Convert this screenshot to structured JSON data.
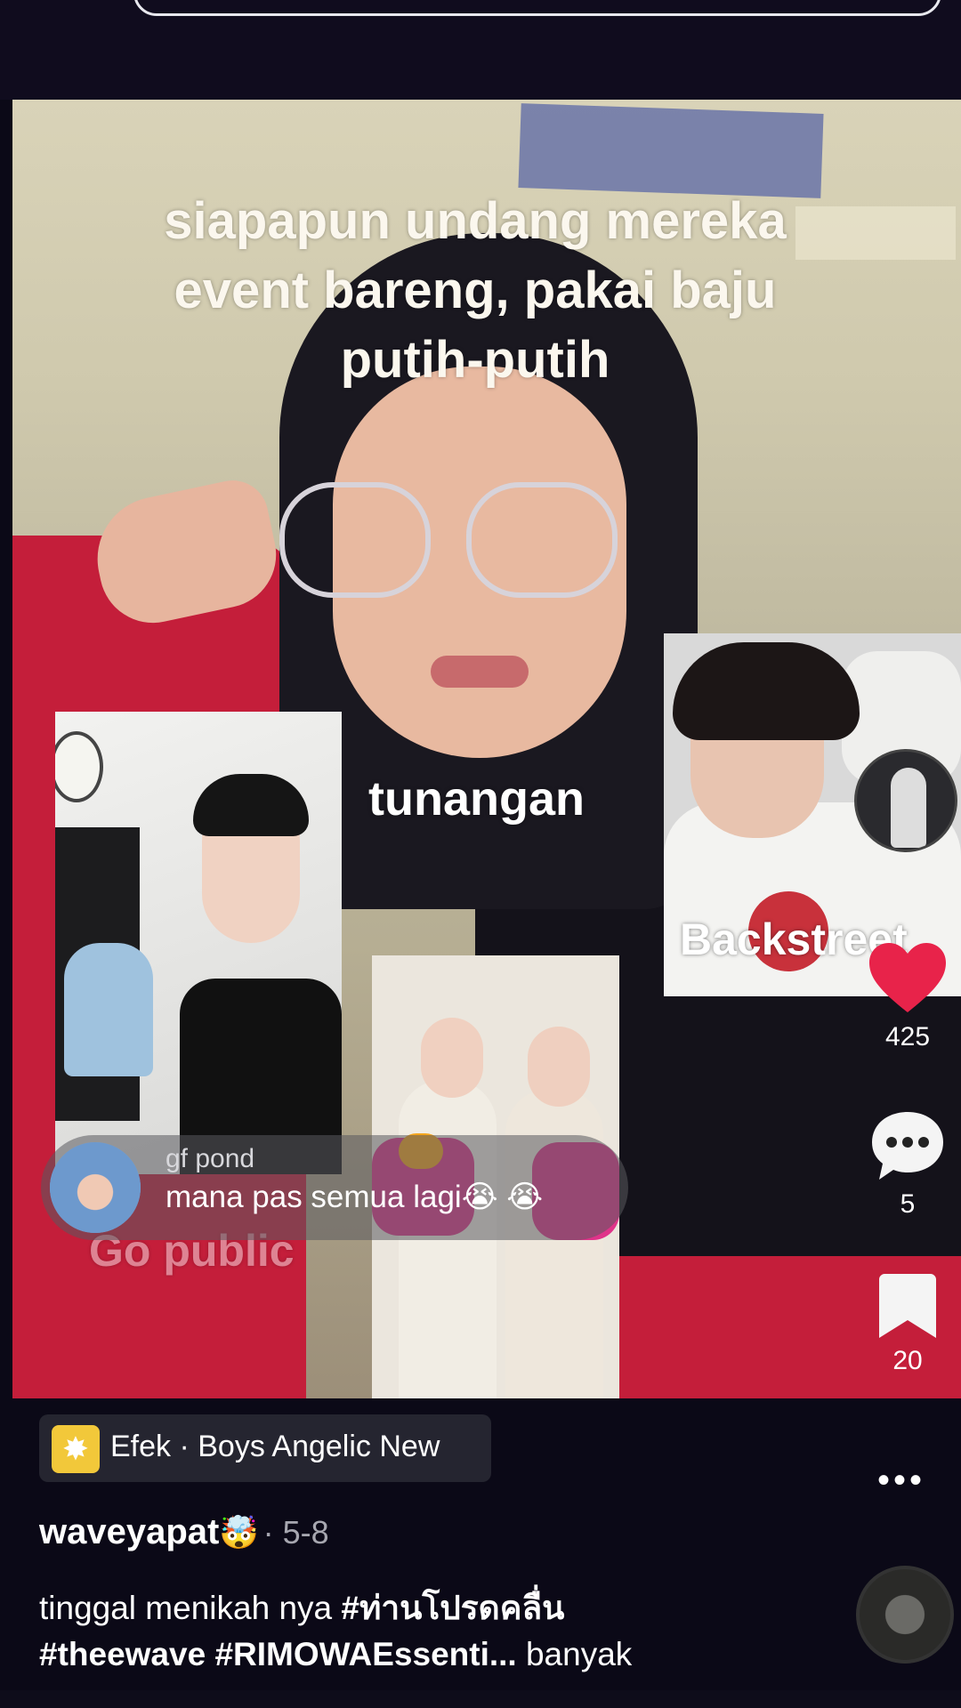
{
  "video": {
    "overlay_text": "siapapun undang mereka event bareng, pakai baju putih-putih",
    "label_tunangan": "tunangan",
    "label_backstreet": "Backstreet",
    "label_go_public": "Go public"
  },
  "live_comment": {
    "user": "gf pond",
    "text": "mana pas semua lagi😭 😭"
  },
  "actions": {
    "like_count": "425",
    "comment_count": "5",
    "save_count": "20"
  },
  "effect": {
    "label": "Efek · Boys Angelic New"
  },
  "post": {
    "author": "waveyapat",
    "author_emoji": "🤯",
    "date": "· 5-8",
    "caption_text": "tinggal menikah nya ",
    "tag1": "#ท่านโปรดคลื่น",
    "tag2": "#theewave",
    "tag3": "#RIMOWAEssenti...",
    "more": " banyak"
  },
  "colors": {
    "like_red": "#e8234a",
    "background": "#0b0917",
    "effect_icon": "#f2c83a"
  },
  "icons": [
    "heart-icon",
    "comment-icon",
    "bookmark-icon",
    "more-icon",
    "effect-icon",
    "music-disc-icon"
  ]
}
